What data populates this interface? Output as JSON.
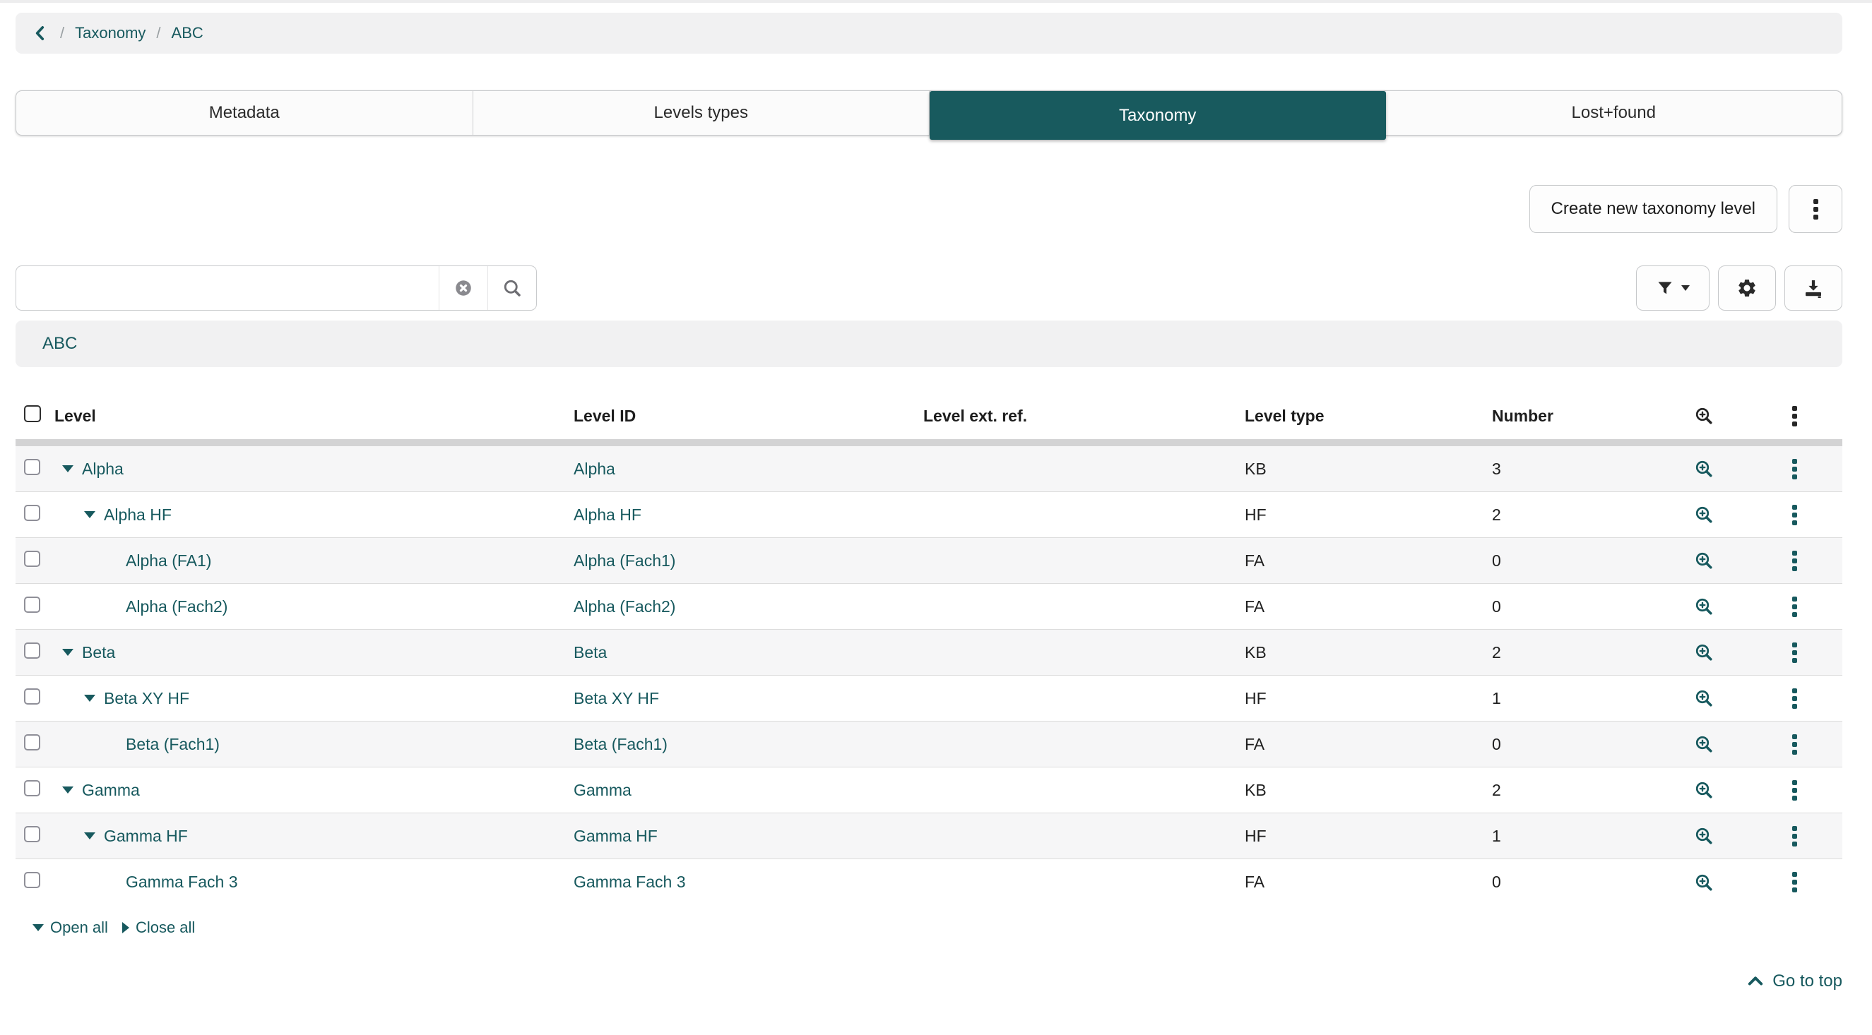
{
  "breadcrumb": {
    "separator": "/",
    "items": [
      "Taxonomy",
      "ABC"
    ]
  },
  "tabs": [
    {
      "label": "Metadata",
      "active": false
    },
    {
      "label": "Levels types",
      "active": false
    },
    {
      "label": "Taxonomy",
      "active": true
    },
    {
      "label": "Lost+found",
      "active": false
    }
  ],
  "actions": {
    "create_label": "Create new taxonomy level"
  },
  "search": {
    "value": "",
    "placeholder": ""
  },
  "section_title": "ABC",
  "table": {
    "columns": {
      "level": "Level",
      "level_id": "Level ID",
      "ext_ref": "Level ext. ref.",
      "type": "Level type",
      "number": "Number"
    },
    "rows": [
      {
        "level": "Alpha",
        "level_id": "Alpha",
        "ext_ref": "",
        "type": "KB",
        "number": "3",
        "indent": 0,
        "expandable": true
      },
      {
        "level": "Alpha HF",
        "level_id": "Alpha HF",
        "ext_ref": "",
        "type": "HF",
        "number": "2",
        "indent": 1,
        "expandable": true
      },
      {
        "level": "Alpha (FA1)",
        "level_id": "Alpha (Fach1)",
        "ext_ref": "",
        "type": "FA",
        "number": "0",
        "indent": 2,
        "expandable": false
      },
      {
        "level": "Alpha (Fach2)",
        "level_id": "Alpha (Fach2)",
        "ext_ref": "",
        "type": "FA",
        "number": "0",
        "indent": 2,
        "expandable": false
      },
      {
        "level": "Beta",
        "level_id": "Beta",
        "ext_ref": "",
        "type": "KB",
        "number": "2",
        "indent": 0,
        "expandable": true
      },
      {
        "level": "Beta XY HF",
        "level_id": "Beta XY HF",
        "ext_ref": "",
        "type": "HF",
        "number": "1",
        "indent": 1,
        "expandable": true
      },
      {
        "level": "Beta (Fach1)",
        "level_id": "Beta (Fach1)",
        "ext_ref": "",
        "type": "FA",
        "number": "0",
        "indent": 2,
        "expandable": false
      },
      {
        "level": "Gamma",
        "level_id": "Gamma",
        "ext_ref": "",
        "type": "KB",
        "number": "2",
        "indent": 0,
        "expandable": true
      },
      {
        "level": "Gamma HF",
        "level_id": "Gamma HF",
        "ext_ref": "",
        "type": "HF",
        "number": "1",
        "indent": 1,
        "expandable": true
      },
      {
        "level": "Gamma Fach 3",
        "level_id": "Gamma Fach 3",
        "ext_ref": "",
        "type": "FA",
        "number": "0",
        "indent": 2,
        "expandable": false
      }
    ],
    "footer": {
      "open_all": "Open all",
      "close_all": "Close all"
    }
  },
  "go_to_top": "Go to top",
  "colors": {
    "accent": "#17595E",
    "tab_active": "#185A5E"
  },
  "icons": {
    "back": "chevron-left-icon",
    "clear": "circle-x-icon",
    "search": "magnifier-icon",
    "filter": "funnel-icon",
    "settings": "gear-icon",
    "download": "download-icon",
    "row_zoom": "zoom-in-icon",
    "menu": "kebab-icon",
    "expand": "caret-down-icon",
    "collapse": "caret-right-icon",
    "go_top": "chevron-up-icon"
  }
}
